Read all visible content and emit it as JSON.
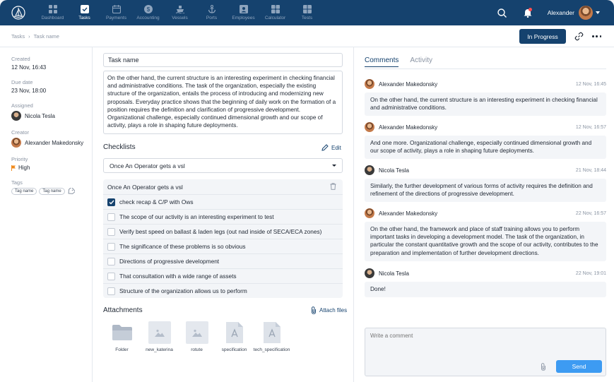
{
  "nav": {
    "items": [
      {
        "label": "Dashboard",
        "icon": "dashboard-icon"
      },
      {
        "label": "Tasks",
        "icon": "tasks-icon"
      },
      {
        "label": "Payments",
        "icon": "calendar-icon"
      },
      {
        "label": "Accounting",
        "icon": "dollar-icon"
      },
      {
        "label": "Vessels",
        "icon": "ship-icon"
      },
      {
        "label": "Ports",
        "icon": "anchor-icon"
      },
      {
        "label": "Employees",
        "icon": "id-card-icon"
      },
      {
        "label": "Calculator",
        "icon": "calculator-icon"
      },
      {
        "label": "Tests",
        "icon": "tests-icon"
      }
    ],
    "active": "Tasks"
  },
  "user": {
    "name": "Alexander"
  },
  "breadcrumb": {
    "root": "Tasks",
    "current": "Task name"
  },
  "status": {
    "label": "In Progress"
  },
  "meta": {
    "created_label": "Created",
    "created_value": "12 Nov, 16:43",
    "due_label": "Due date",
    "due_value": "23 Nov, 18:00",
    "assigned_label": "Assigned",
    "assigned_value": "Nicola Tesla",
    "creator_label": "Creator",
    "creator_value": "Alexander Makedonsky",
    "priority_label": "Priority",
    "priority_value": "High",
    "tags_label": "Tags",
    "tags": [
      "Tag name",
      "Tag name"
    ]
  },
  "task": {
    "title": "Task name",
    "description": "On the other hand, the current structure is an interesting experiment in checking financial and administrative conditions. The task of the organization, especially the existing structure of the organization, entails the process of introducing and modernizing new proposals. Everyday practice shows that the beginning of daily work on the formation of a position requires the definition and clarification of progressive development. Organizational challenge, especially continued dimensional growth and our scope of activity, plays a role in shaping future deployments."
  },
  "checklists": {
    "title": "Checklists",
    "edit_label": "Edit",
    "selected": "Once An Operator gets a vsl",
    "list_title": "Once An Operator gets a vsl",
    "items": [
      {
        "text": "check recap & C/P with Ows",
        "checked": true
      },
      {
        "text": "The scope of our activity is an interesting experiment to test",
        "checked": false
      },
      {
        "text": "Verify best speed on ballast & laden legs (out nad inside of SECA/ECA zones)",
        "checked": false
      },
      {
        "text": "The significance of these problems is so obvious",
        "checked": false
      },
      {
        "text": "Directions of progressive development",
        "checked": false
      },
      {
        "text": "That consultation with a wide range of assets",
        "checked": false
      },
      {
        "text": "Structure of the organization allows us to perform",
        "checked": false
      }
    ]
  },
  "attachments": {
    "title": "Attachments",
    "attach_label": "Attach files",
    "files": [
      {
        "name": "Folder",
        "kind": "folder"
      },
      {
        "name": "new_katerina",
        "kind": "image"
      },
      {
        "name": "rotute",
        "kind": "image"
      },
      {
        "name": "specification",
        "kind": "doc"
      },
      {
        "name": "tech_specification",
        "kind": "doc"
      }
    ]
  },
  "comments_panel": {
    "tab_comments": "Comments",
    "tab_activity": "Activity",
    "comments": [
      {
        "author": "Alexander Makedonsky",
        "time": "12 Nov, 16:45",
        "text": "On the other hand, the current structure is an interesting experiment in checking financial and administrative conditions."
      },
      {
        "author": "Alexander Makedonsky",
        "time": "12 Nov, 16:57",
        "text": "And one more. Organizational challenge, especially continued dimensional growth and our scope of activity, plays a role in shaping future deployments."
      },
      {
        "author": "Nicola Tesla",
        "time": "21 Nov, 18:44",
        "text": "Similarly, the further development of various forms of activity requires the definition and refinement of the directions of progressive development."
      },
      {
        "author": "Alexander Makedonsky",
        "time": "22 Nov, 16:57",
        "text": "On the other hand, the framework and place of staff training allows you to perform important tasks in developing a development model. The task of the organization, in particular the constant quantitative growth and the scope of our activity, contributes to the preparation and implementation of further development directions."
      },
      {
        "author": "Nicola Tesla",
        "time": "22 Nov, 19:01",
        "text": "Done!"
      }
    ],
    "compose_placeholder": "Write a comment",
    "send_label": "Send"
  },
  "colors": {
    "primary": "#15426e",
    "accent": "#3d9bf2",
    "priority": "#f08a1c"
  }
}
